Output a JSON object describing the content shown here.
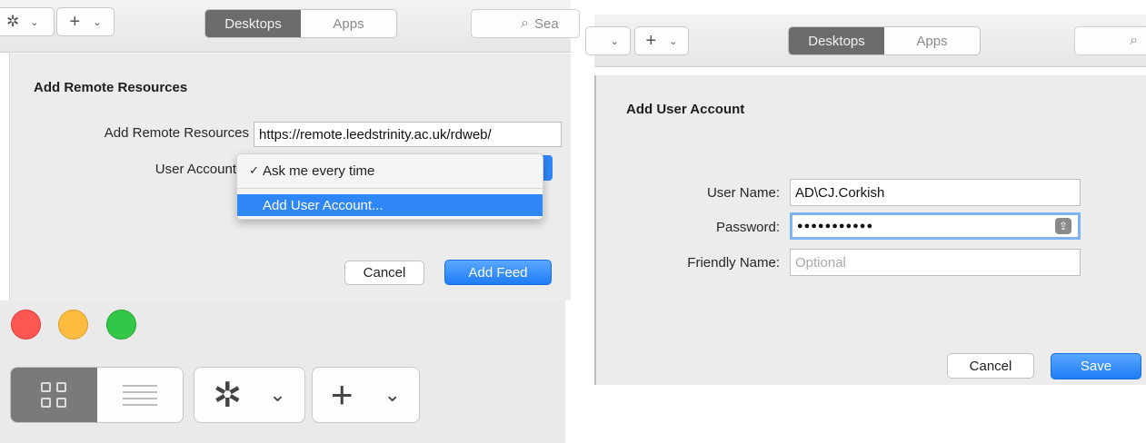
{
  "panel_left": {
    "toolbar": {
      "tab_desktops": "Desktops",
      "tab_apps": "Apps",
      "search_text": "Sea"
    },
    "dialog": {
      "heading": "Add Remote Resources",
      "url_label": "Add Remote Resources",
      "url_value": "https://remote.leedstrinity.ac.uk/rdweb/",
      "account_label": "User Account",
      "menu": [
        {
          "label": "Ask me every time",
          "checked": true
        },
        {
          "label": "Add User Account...",
          "checked": false
        }
      ],
      "cancel": "Cancel",
      "add_feed": "Add Feed"
    }
  },
  "panel_right": {
    "toolbar": {
      "tab_desktops": "Desktops",
      "tab_apps": "Apps"
    },
    "dialog": {
      "heading": "Add User Account",
      "username_label": "User Name:",
      "username_value": "AD\\CJ.Corkish",
      "password_label": "Password:",
      "password_value": "●●●●●●●●●●●",
      "friendly_label": "Friendly Name:",
      "friendly_placeholder": "Optional",
      "cancel": "Cancel",
      "save": "Save"
    }
  },
  "window_controls": {
    "close_color": "#fc5753",
    "minimize_color": "#fdbc40",
    "zoom_color": "#33c748"
  },
  "accent_color": "#2f86f6"
}
